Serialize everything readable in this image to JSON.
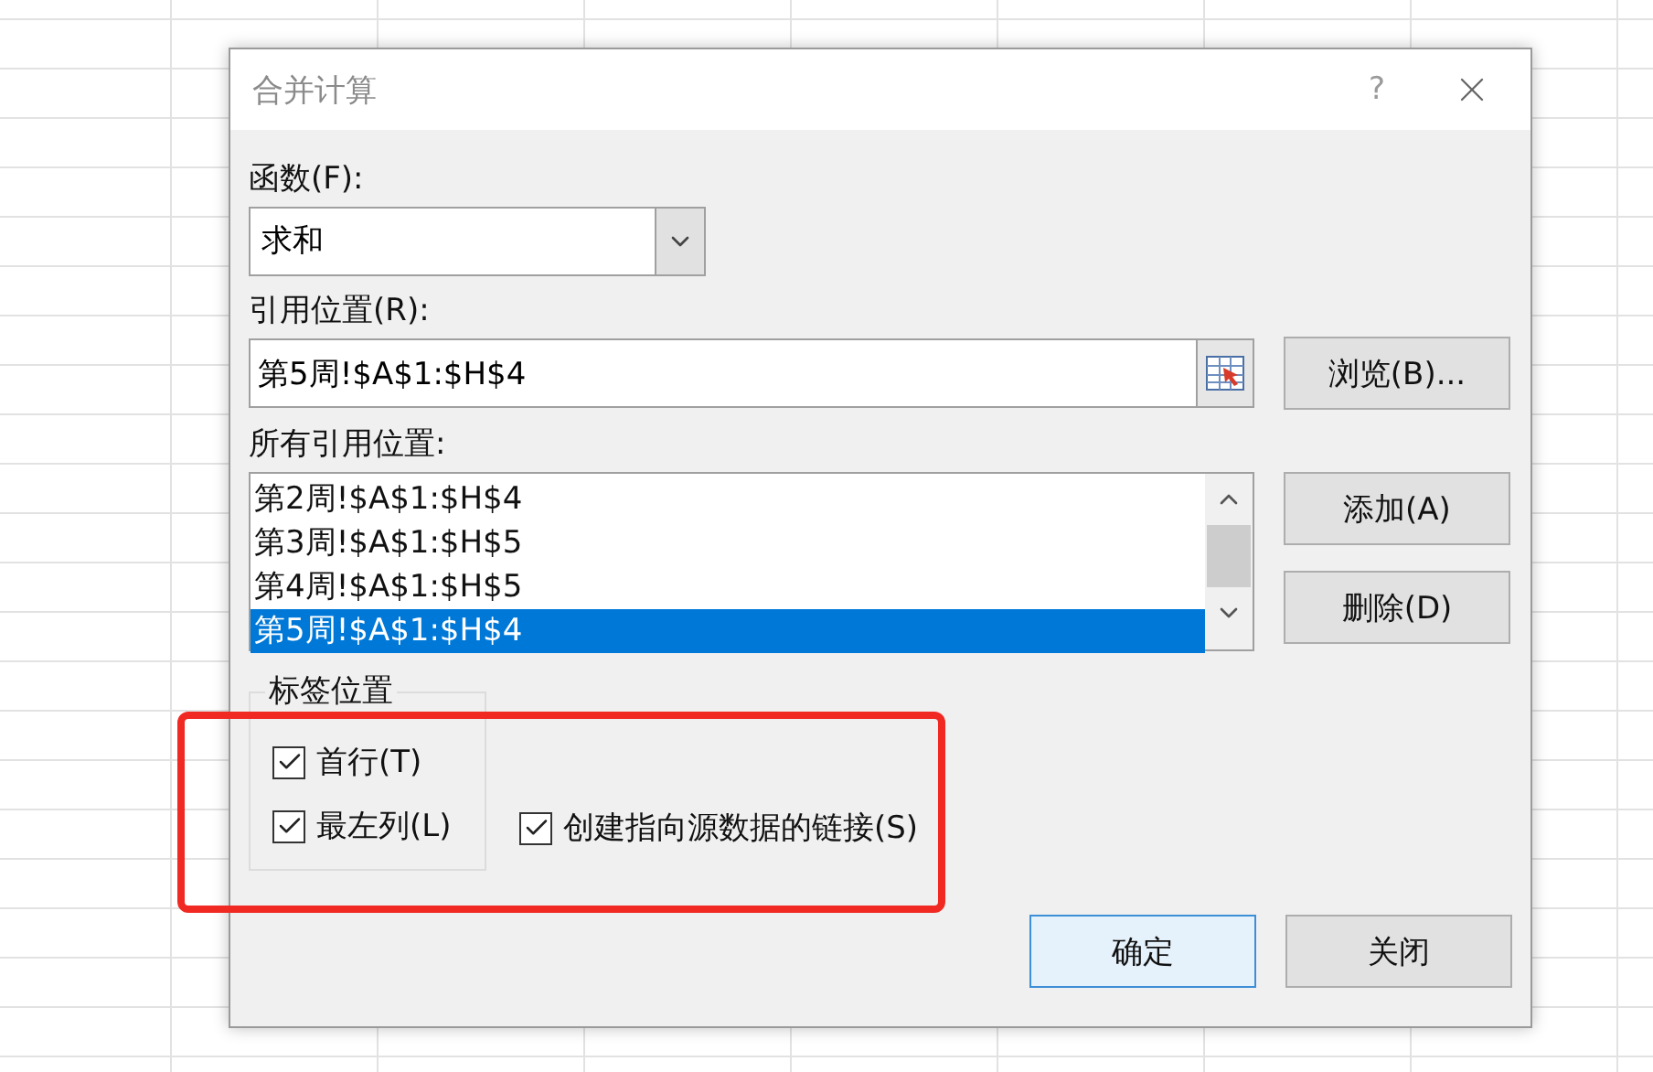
{
  "window": {
    "title": "合并计算",
    "help": "?"
  },
  "function": {
    "label": "函数(F):",
    "value": "求和"
  },
  "reference": {
    "label": "引用位置(R):",
    "value": "第5周!$A$1:$H$4"
  },
  "browse_button": "浏览(B)...",
  "all_references": {
    "label": "所有引用位置:",
    "items": [
      {
        "text": "第2周!$A$1:$H$4",
        "selected": false
      },
      {
        "text": "第3周!$A$1:$H$5",
        "selected": false
      },
      {
        "text": "第4周!$A$1:$H$5",
        "selected": false
      },
      {
        "text": "第5周!$A$1:$H$4",
        "selected": true
      }
    ]
  },
  "side_buttons": [
    "添加(A)",
    "删除(D)"
  ],
  "label_position": {
    "title": "标签位置",
    "options": [
      {
        "label": "首行(T)",
        "checked": true
      },
      {
        "label": "最左列(L)",
        "checked": true
      }
    ]
  },
  "link_option": {
    "label": "创建指向源数据的链接(S)",
    "checked": true
  },
  "footer_buttons": [
    {
      "label": "确定",
      "default": true
    },
    {
      "label": "关闭",
      "default": false
    }
  ]
}
